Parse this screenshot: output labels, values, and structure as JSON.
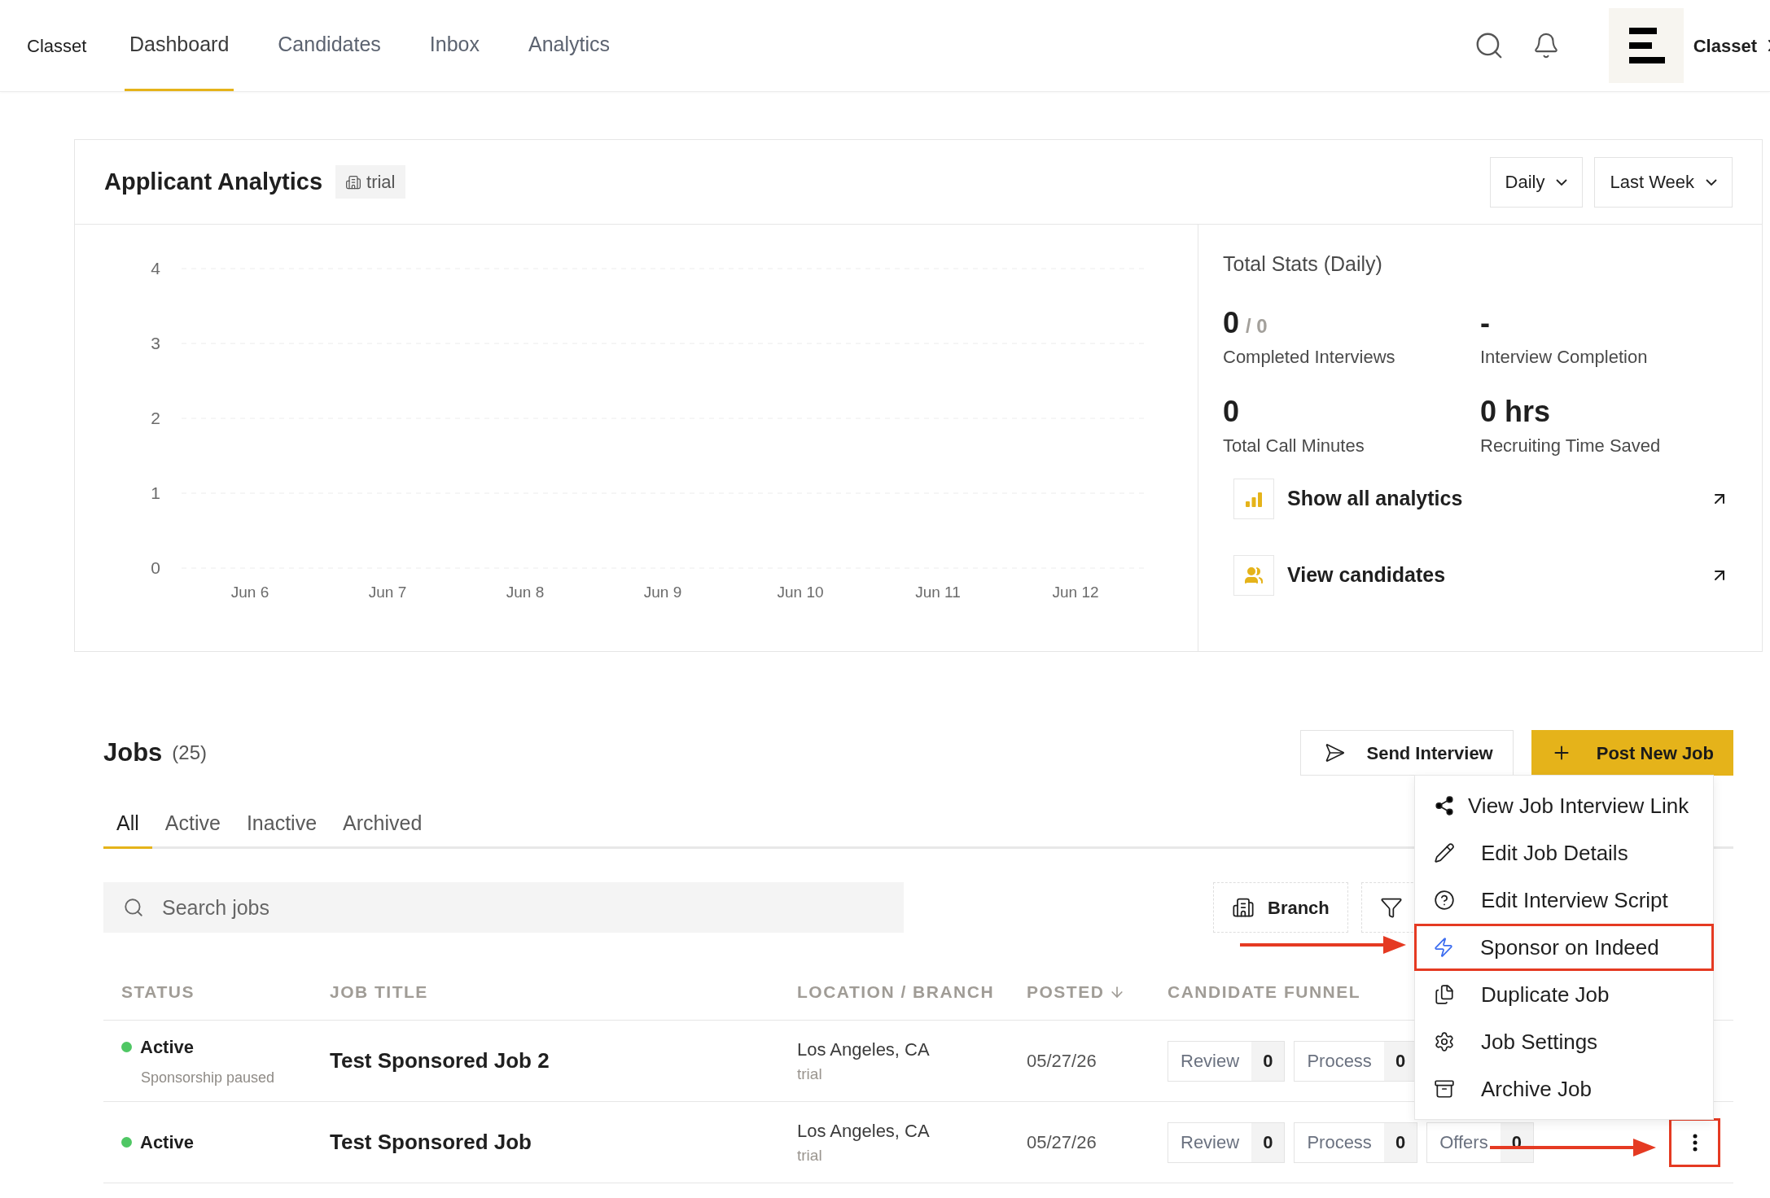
{
  "header": {
    "logo": "Classet",
    "tabs": [
      {
        "label": "Dashboard",
        "selected": true
      },
      {
        "label": "Candidates",
        "selected": false
      },
      {
        "label": "Inbox",
        "selected": false
      },
      {
        "label": "Analytics",
        "selected": false
      }
    ],
    "account": "Classet"
  },
  "analytics": {
    "title": "Applicant Analytics",
    "badge": "trial",
    "filters": [
      "Daily",
      "Last Week"
    ],
    "chart_data": {
      "type": "bar",
      "grid": true,
      "categories": [
        "Jun 6",
        "Jun 7",
        "Jun 8",
        "Jun 9",
        "Jun 10",
        "Jun 11",
        "Jun 12"
      ],
      "yticks": [
        0,
        1,
        2,
        3,
        4
      ],
      "ylim": [
        0,
        4
      ],
      "values": [
        0,
        0,
        0,
        0,
        0,
        0,
        0
      ]
    },
    "stats_title": "Total Stats (Daily)",
    "stats": [
      {
        "value": "0",
        "total": "/ 0",
        "label": "Completed Interviews"
      },
      {
        "value": "-",
        "label": "Interview Completion"
      },
      {
        "value": "0",
        "label": "Total Call Minutes"
      },
      {
        "value": "0 hrs",
        "label": "Recruiting Time Saved"
      }
    ],
    "links": [
      {
        "kind": "chart",
        "label": "Show all analytics"
      },
      {
        "kind": "people",
        "label": "View candidates"
      }
    ]
  },
  "jobs": {
    "title": "Jobs",
    "count": "(25)",
    "buttons": [
      {
        "kind": "send",
        "label": "Send Interview"
      },
      {
        "kind": "add",
        "label": "Post New Job"
      }
    ],
    "tabs": [
      {
        "label": "All",
        "selected": true
      },
      {
        "label": "Active",
        "selected": false
      },
      {
        "label": "Inactive",
        "selected": false
      },
      {
        "label": "Archived",
        "selected": false
      }
    ],
    "search": {
      "placeholder": "Search jobs"
    },
    "branch_button": "Branch",
    "columns": [
      "STATUS",
      "JOB TITLE",
      "LOCATION / BRANCH",
      "POSTED",
      "CANDIDATE FUNNEL"
    ],
    "rows": [
      {
        "status": "Active",
        "color": "#4fc764",
        "note": "Sponsorship paused",
        "title": "Test Sponsored Job 2",
        "location": "Los Angeles, CA",
        "branch": "trial",
        "posted": "05/27/26",
        "funnel": [
          {
            "label": "Review",
            "count": "0"
          },
          {
            "label": "Process",
            "count": "0"
          }
        ]
      },
      {
        "status": "Active",
        "color": "#4fc764",
        "title": "Test Sponsored Job",
        "location": "Los Angeles, CA",
        "branch": "trial",
        "posted": "05/27/26",
        "funnel": [
          {
            "label": "Review",
            "count": "0"
          },
          {
            "label": "Process",
            "count": "0"
          },
          {
            "label": "Offers",
            "count": "0"
          }
        ],
        "menu_highlighted": true
      }
    ]
  },
  "menu": {
    "items": [
      {
        "kind": "share",
        "label": "View Job Interview Link",
        "highlighted": false
      },
      {
        "kind": "edit",
        "label": "Edit Job Details",
        "highlighted": false
      },
      {
        "kind": "help",
        "label": "Edit Interview Script",
        "highlighted": false
      },
      {
        "kind": "sponsor",
        "label": "Sponsor on Indeed",
        "highlighted": true
      },
      {
        "kind": "duplicate",
        "label": "Duplicate Job",
        "highlighted": false
      },
      {
        "kind": "settings",
        "label": "Job Settings",
        "highlighted": false
      },
      {
        "kind": "archive",
        "label": "Archive Job",
        "highlighted": false
      }
    ]
  }
}
